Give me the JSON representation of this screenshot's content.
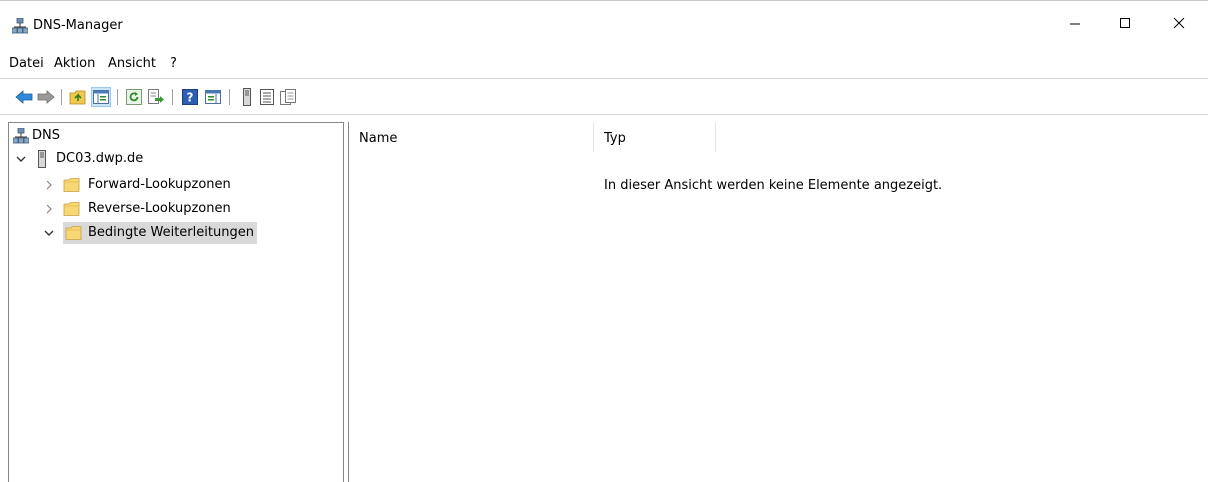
{
  "window": {
    "title": "DNS-Manager",
    "controls": {
      "minimize": "minimize-icon",
      "maximize": "maximize-icon",
      "close": "close-icon"
    }
  },
  "menu": {
    "items": [
      {
        "label": "Datei"
      },
      {
        "label": "Aktion"
      },
      {
        "label": "Ansicht"
      },
      {
        "label": "?"
      }
    ]
  },
  "toolbar": {
    "buttons": [
      {
        "icon": "back-arrow-icon"
      },
      {
        "icon": "forward-arrow-icon"
      },
      {
        "icon": "up-folder-icon"
      },
      {
        "icon": "show-hide-console-tree-icon",
        "active": true
      },
      {
        "icon": "refresh-icon"
      },
      {
        "icon": "export-list-icon"
      },
      {
        "icon": "help-icon"
      },
      {
        "icon": "action-pane-icon"
      },
      {
        "icon": "server-icon"
      },
      {
        "icon": "properties-list-icon"
      },
      {
        "icon": "copy-properties-icon"
      }
    ]
  },
  "tree": {
    "root": {
      "label": "DNS",
      "icon": "dns-network-icon"
    },
    "server": {
      "label": "DC03.dwp.de",
      "icon": "server-icon",
      "expanded": true
    },
    "children": [
      {
        "label": "Forward-Lookupzonen",
        "icon": "folder-icon",
        "expanded": false
      },
      {
        "label": "Reverse-Lookupzonen",
        "icon": "folder-icon",
        "expanded": false
      },
      {
        "label": "Bedingte Weiterleitungen",
        "icon": "folder-icon",
        "expanded": true,
        "selected": true
      }
    ]
  },
  "list": {
    "columns": [
      {
        "label": "Name"
      },
      {
        "label": "Typ"
      }
    ],
    "empty_message": "In dieser Ansicht werden keine Elemente angezeigt."
  },
  "colors": {
    "selection": "#d9d9d9",
    "toolbar_active": "#cce4f7",
    "folder": "#f8d775"
  }
}
